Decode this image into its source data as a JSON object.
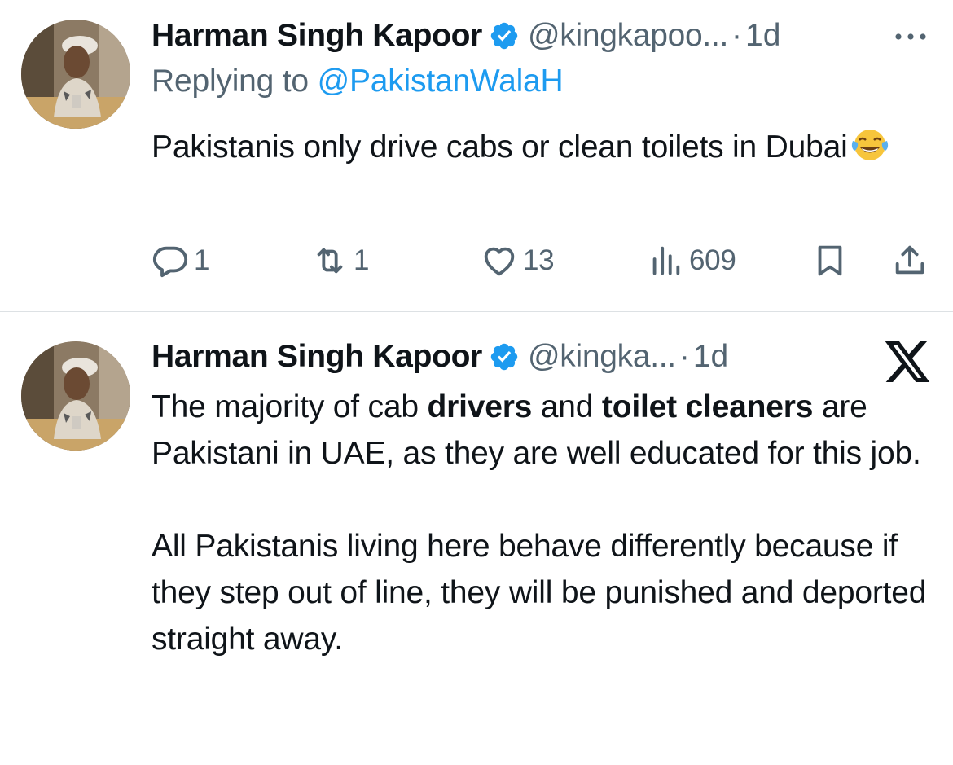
{
  "colors": {
    "text": "#0f1419",
    "secondary": "#536471",
    "link": "#1d9bf0",
    "verified": "#1d9bf0",
    "divider": "#dde1e4"
  },
  "tweets": [
    {
      "author_name": "Harman Singh Kapoor",
      "handle": "@kingkapoo...",
      "separator": "·",
      "time": "1d",
      "reply_prefix": "Replying to",
      "reply_to": "@PakistanWalaH",
      "text": "Pakistanis only drive cabs or clean toilets in Dubai",
      "emoji_icon": "face-with-tears-of-joy-icon",
      "actions": {
        "replies": "1",
        "retweets": "1",
        "likes": "13",
        "views": "609"
      },
      "icons": [
        "reply-icon",
        "retweet-icon",
        "like-icon",
        "views-icon",
        "bookmark-icon",
        "share-icon",
        "more-icon",
        "verified-badge-icon"
      ]
    },
    {
      "author_name": "Harman Singh Kapoor",
      "handle": "@kingka...",
      "separator": "·",
      "time": "1d",
      "text_parts": {
        "p1_a": "The majority of cab ",
        "p1_b": "drivers",
        "p1_c": " and ",
        "p1_d": "toilet cleaners",
        "p1_e": " are Pakistani in UAE, as they are well educated for this job.",
        "p2": "All Pakistanis living here behave differently because if they step out of line, they will be punished and deported straight away."
      },
      "icons": [
        "x-logo-icon",
        "verified-badge-icon"
      ]
    }
  ]
}
